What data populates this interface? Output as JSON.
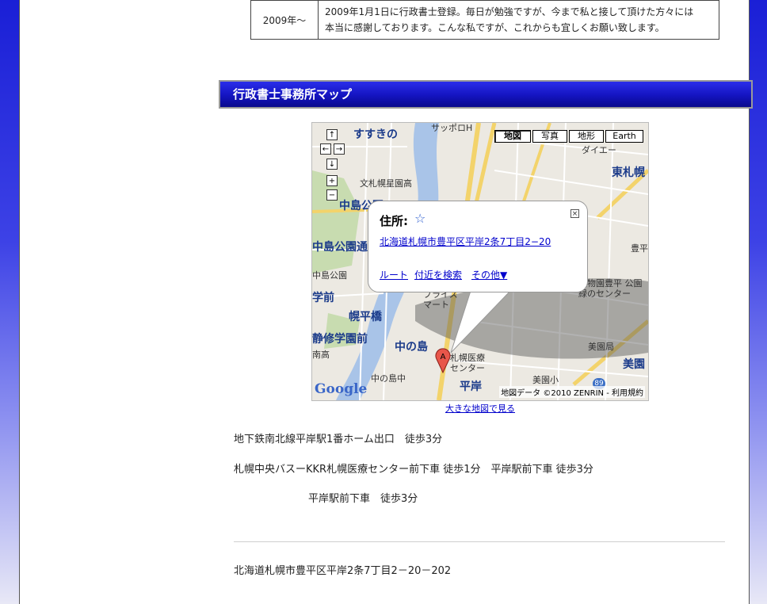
{
  "history": {
    "year": "2009年～",
    "line1": "2009年1月1日に行政書士登録。毎日が勉強ですが、今まで私と接して頂けた方々には",
    "line2": "本当に感謝しております。こんな私ですが、これからも宜しくお願い致します。"
  },
  "section": {
    "title": "行政書士事務所マップ"
  },
  "map": {
    "type_buttons": [
      "地図",
      "写真",
      "地形",
      "Earth"
    ],
    "nav": {
      "up": "↑",
      "left": "←",
      "right": "→",
      "down": "↓",
      "zoom_in": "+",
      "zoom_out": "−"
    },
    "info": {
      "title": "住所:",
      "star": "☆",
      "close": "×",
      "address": "北海道札幌市豊平区平岸2条7丁目2−20",
      "links": [
        "ルート",
        "付近を検索",
        "その他▼"
      ]
    },
    "labels": {
      "susukino": "すすきの",
      "sapporo_h": "サッポロH",
      "daiei": "ダイエー",
      "higashi": "東札幌",
      "bunsapporo": "文札幌星園高",
      "nakajima_koen": "中島公園",
      "nakajima_koen_dori": "中島公園通",
      "nakajima_koen_small": "中島公園",
      "horohira": "幌平橋",
      "nakanoshima": "中の島",
      "shugakuen": "静修学園前",
      "minamiko": "南高",
      "hirakishi": "平岸",
      "misono": "美園",
      "price_mart": "プライス マート",
      "iryo_center": "札幌医療 センター",
      "nakanoshima_chu": "中の島中",
      "misono_sho": "美園小",
      "misonokyoku": "美園局",
      "toyohira": "豊平",
      "shokubutsu": "植物園豊平 公園緑のセンター",
      "ko": "学前",
      "marker": "A",
      "route89": "89"
    },
    "google": "Google",
    "copyright": "地図データ ©2010 ZENRIN - 利用規約"
  },
  "large_map_link": "大きな地図で見る",
  "access": {
    "line1": "地下鉄南北線平岸駅1番ホーム出口　徒歩3分",
    "line2": "札幌中央バスーKKR札幌医療センター前下車 徒歩1分　平岸駅前下車 徒歩3分",
    "line3": "平岸駅前下車　徒歩3分"
  },
  "address": "北海道札幌市豊平区平岸2条7丁目2－20－202",
  "colors": {
    "header": "#1414c0",
    "link": "#0000cc",
    "background": "#1a1fd6"
  }
}
